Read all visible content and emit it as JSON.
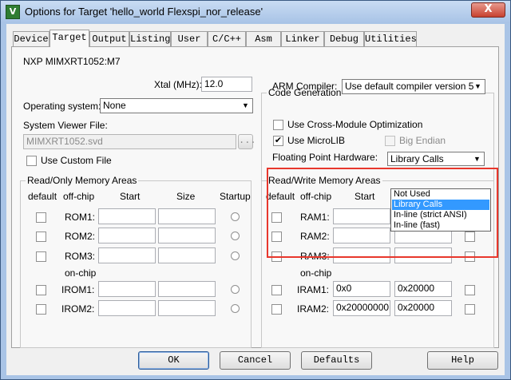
{
  "window": {
    "title": "Options for Target 'hello_world Flexspi_nor_release'",
    "close_glyph": "X",
    "app_icon_glyph": "V"
  },
  "tabs": [
    {
      "label": "Device"
    },
    {
      "label": "Target"
    },
    {
      "label": "Output"
    },
    {
      "label": "Listing"
    },
    {
      "label": "User"
    },
    {
      "label": "C/C++"
    },
    {
      "label": "Asm"
    },
    {
      "label": "Linker"
    },
    {
      "label": "Debug"
    },
    {
      "label": "Utilities"
    }
  ],
  "active_tab": "Target",
  "target": {
    "device_name": "NXP MIMXRT1052:M7",
    "xtal_label": "Xtal (MHz):",
    "xtal_value": "12.0",
    "os_label": "Operating system:",
    "os_value": "None",
    "svd_label": "System Viewer File:",
    "svd_value": "MIMXRT1052.svd",
    "svd_browse": "...",
    "custom_file_label": "Use Custom File"
  },
  "codegen": {
    "title": "Code Generation",
    "compiler_label": "ARM Compiler:",
    "compiler_value": "Use default compiler version 5",
    "cross_module_label": "Use Cross-Module Optimization",
    "microlib_label": "Use MicroLIB",
    "microlib_check": "✔",
    "big_endian_label": "Big Endian",
    "fp_label": "Floating Point Hardware:",
    "fp_value": "Library Calls",
    "fp_options": [
      "Not Used",
      "Library Calls",
      "In-line (strict ANSI)",
      "In-line (fast)"
    ],
    "fp_selected": "Library Calls"
  },
  "rom": {
    "title": "Read/Only Memory Areas",
    "headers": {
      "default": "default",
      "offchip": "off-chip",
      "start": "Start",
      "size": "Size",
      "startup": "Startup"
    },
    "onchip_label": "on-chip",
    "rows": [
      {
        "name": "ROM1:",
        "start": "",
        "size": ""
      },
      {
        "name": "ROM2:",
        "start": "",
        "size": ""
      },
      {
        "name": "ROM3:",
        "start": "",
        "size": ""
      },
      {
        "name": "IROM1:",
        "start": "",
        "size": ""
      },
      {
        "name": "IROM2:",
        "start": "",
        "size": ""
      }
    ]
  },
  "ram": {
    "title": "Read/Write Memory Areas",
    "headers": {
      "default": "default",
      "offchip": "off-chip",
      "start": "Start"
    },
    "onchip_label": "on-chip",
    "rows": [
      {
        "name": "RAM1:",
        "start": "",
        "size": ""
      },
      {
        "name": "RAM2:",
        "start": "",
        "size": ""
      },
      {
        "name": "RAM3:",
        "start": "",
        "size": ""
      },
      {
        "name": "IRAM1:",
        "start": "0x0",
        "size": "0x20000"
      },
      {
        "name": "IRAM2:",
        "start": "0x20000000",
        "size": "0x20000"
      }
    ]
  },
  "buttons": {
    "ok": "OK",
    "cancel": "Cancel",
    "defaults": "Defaults",
    "help": "Help"
  },
  "colors": {
    "highlight": "#e8372c",
    "selection": "#3399ff"
  }
}
